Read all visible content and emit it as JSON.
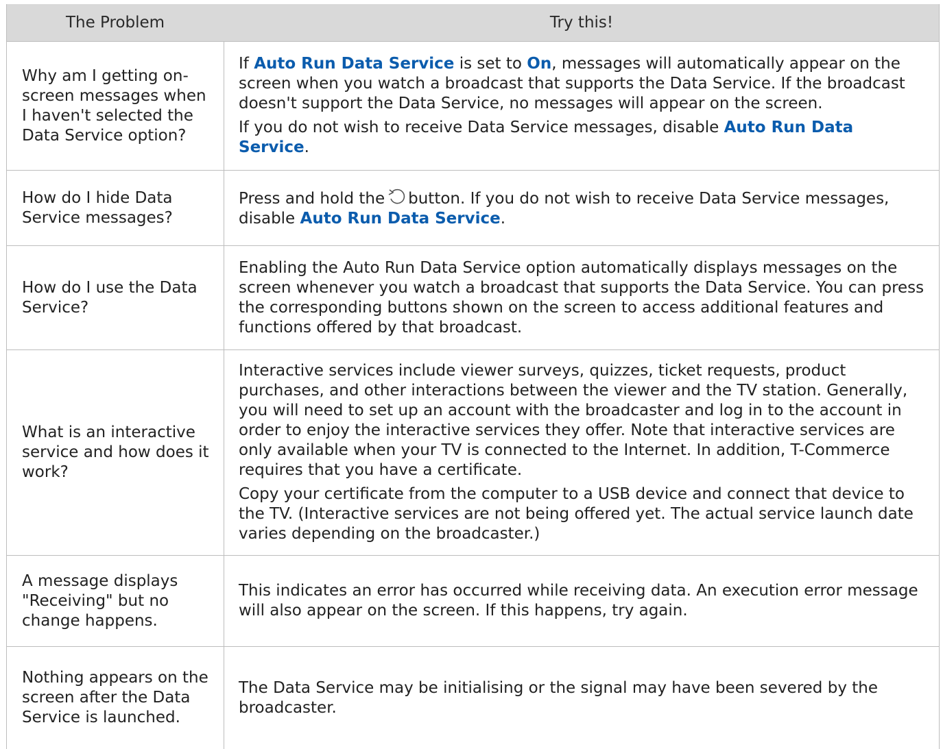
{
  "header": {
    "problem": "The Problem",
    "solution": "Try this!"
  },
  "rows": [
    {
      "problem": "Why am I getting on-screen messages when I haven't selected the Data Service option?",
      "s1a": "If ",
      "s1b": "Auto Run Data Service",
      "s1c": " is set to ",
      "s1d": "On",
      "s1e": ", messages will automatically appear on the screen when you watch a broadcast that supports the Data Service. If the broadcast doesn't support the Data Service, no messages will appear on the screen.",
      "s2a": "If you do not wish to receive Data Service messages, disable ",
      "s2b": "Auto Run Data Service",
      "s2c": "."
    },
    {
      "problem": "How do I hide Data Service messages?",
      "s1a": "Press and hold the",
      "icon": "return-arrow-icon",
      "s1b": "button. If you do not wish to receive Data Service messages, disable ",
      "s1c": "Auto Run Data Service",
      "s1d": "."
    },
    {
      "problem": "How do I use the Data Service?",
      "s1": "Enabling the Auto Run Data Service option automatically displays messages on the screen whenever you watch a broadcast that supports the Data Service. You can press the corresponding buttons shown on the screen to access additional features and functions offered by that broadcast."
    },
    {
      "problem": "What is an interactive service and how does it work?",
      "s1": "Interactive services include viewer surveys, quizzes, ticket requests, product purchases, and other interactions between the viewer and the TV station. Generally, you will need to set up an account with the broadcaster and log in to the account in order to enjoy the interactive services they offer. Note that interactive services are only available when your TV is connected to the Internet. In addition, T-Commerce requires that you have a certificate.",
      "s2": "Copy your certificate from the computer to a USB device and connect that device to the TV. (Interactive services are not being offered yet. The actual service launch date varies depending on the broadcaster.)"
    },
    {
      "problem": "A message displays \"Receiving\" but no change happens.",
      "s1": "This indicates an error has occurred while receiving data. An execution error message will also appear on the screen. If this happens, try again."
    },
    {
      "problem": "Nothing appears on the screen after the Data Service is launched.",
      "s1": "The Data Service may be initialising or the signal may have been severed by the broadcaster."
    }
  ],
  "colors": {
    "header_bg": "#d9d9d9",
    "highlight": "#0b5cad",
    "border": "#bdbdbd"
  }
}
